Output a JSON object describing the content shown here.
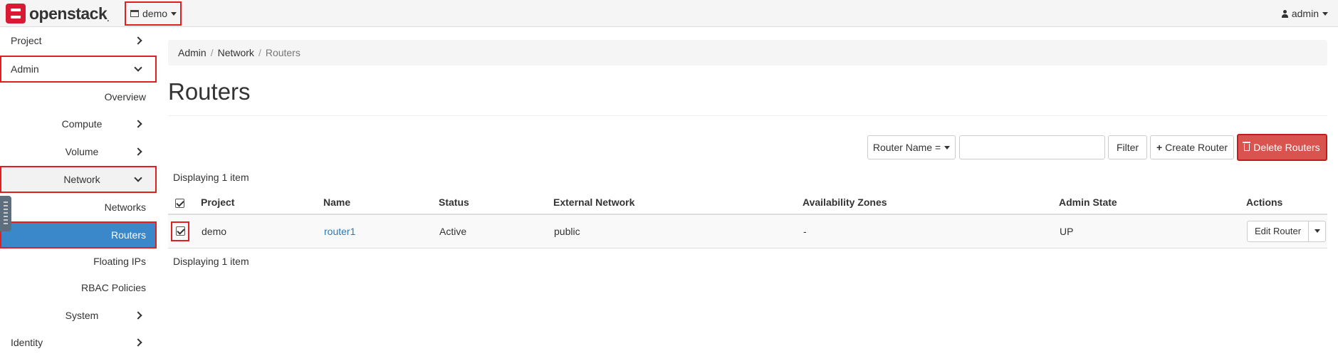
{
  "topbar": {
    "brand": "openstack",
    "brand_mark": ".",
    "project": "demo",
    "user": "admin"
  },
  "sidebar": {
    "items": [
      {
        "label": "Project"
      },
      {
        "label": "Admin"
      },
      {
        "label": "Overview"
      },
      {
        "label": "Compute"
      },
      {
        "label": "Volume"
      },
      {
        "label": "Network"
      },
      {
        "label": "Networks"
      },
      {
        "label": "Routers"
      },
      {
        "label": "Floating IPs"
      },
      {
        "label": "RBAC Policies"
      },
      {
        "label": "System"
      },
      {
        "label": "Identity"
      }
    ]
  },
  "breadcrumb": [
    "Admin",
    "Network",
    "Routers"
  ],
  "page": {
    "title": "Routers"
  },
  "toolbar": {
    "filter_field": "Router Name =",
    "filter_value": "",
    "filter_label": "Filter",
    "create_label": "Create Router",
    "delete_label": "Delete Routers"
  },
  "table": {
    "count_text": "Displaying 1 item",
    "headers": [
      "Project",
      "Name",
      "Status",
      "External Network",
      "Availability Zones",
      "Admin State",
      "Actions"
    ],
    "rows": [
      {
        "project": "demo",
        "name": "router1",
        "status": "Active",
        "external_network": "public",
        "availability_zones": "-",
        "admin_state": "UP",
        "action": "Edit Router"
      }
    ]
  },
  "colors": {
    "accent": "#3a87c9",
    "danger": "#d9534f",
    "brand": "#da1a32",
    "highlight": "#e02020"
  }
}
